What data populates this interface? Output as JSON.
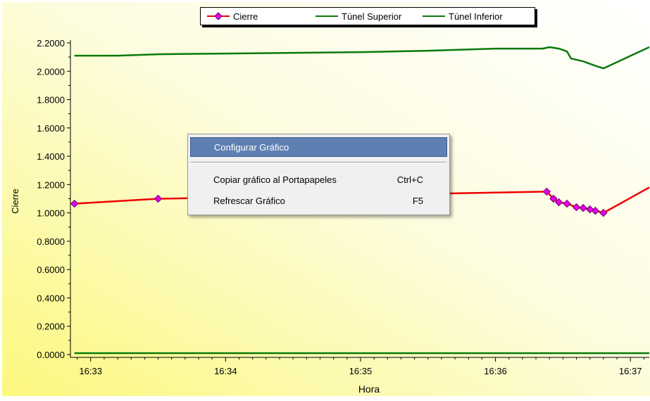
{
  "chart_data": {
    "type": "line",
    "ylabel": "Cierre",
    "xlabel": "Hora",
    "ylim": [
      0,
      2.2
    ],
    "xlim_minutes": [
      32.85,
      37.14
    ],
    "y_ticks": [
      "0.0000",
      "0.2000",
      "0.4000",
      "0.6000",
      "0.8000",
      "1.0000",
      "1.2000",
      "1.4000",
      "1.6000",
      "1.8000",
      "2.0000",
      "2.2000"
    ],
    "x_ticks": [
      {
        "label": "16:33",
        "t": 33
      },
      {
        "label": "16:34",
        "t": 34
      },
      {
        "label": "16:35",
        "t": 35
      },
      {
        "label": "16:36",
        "t": 36
      },
      {
        "label": "16:37",
        "t": 37
      }
    ],
    "grid": false,
    "legend_position": "top-center",
    "series": [
      {
        "name": "Cierre",
        "color": "#ee0000",
        "marker_color": "#e600e6",
        "markers": true,
        "points": [
          [
            32.88,
            1.065
          ],
          [
            33.5,
            1.1
          ],
          [
            36.38,
            1.15
          ],
          [
            36.43,
            1.1
          ],
          [
            36.47,
            1.075
          ],
          [
            36.53,
            1.065
          ],
          [
            36.6,
            1.04
          ],
          [
            36.65,
            1.035
          ],
          [
            36.7,
            1.025
          ],
          [
            36.74,
            1.015
          ],
          [
            36.8,
            1.0
          ],
          [
            37.14,
            1.18
          ]
        ]
      },
      {
        "name": "Túnel Superior",
        "color": "#0a7a0a",
        "markers": false,
        "points": [
          [
            32.88,
            2.11
          ],
          [
            33.2,
            2.11
          ],
          [
            33.5,
            2.12
          ],
          [
            34.0,
            2.125
          ],
          [
            34.5,
            2.13
          ],
          [
            35.0,
            2.135
          ],
          [
            35.5,
            2.145
          ],
          [
            36.0,
            2.16
          ],
          [
            36.35,
            2.16
          ],
          [
            36.4,
            2.17
          ],
          [
            36.47,
            2.16
          ],
          [
            36.53,
            2.14
          ],
          [
            36.56,
            2.09
          ],
          [
            36.65,
            2.07
          ],
          [
            36.75,
            2.035
          ],
          [
            36.8,
            2.02
          ],
          [
            37.14,
            2.17
          ]
        ]
      },
      {
        "name": "Túnel Inferior",
        "color": "#0a7a0a",
        "markers": false,
        "points": [
          [
            32.88,
            0.01
          ],
          [
            37.14,
            0.01
          ]
        ]
      }
    ]
  },
  "context_menu": {
    "items": [
      {
        "label": "Configurar Gráfico",
        "shortcut": "",
        "highlighted": true
      },
      {
        "label": "Copiar gráfico al Portapapeles",
        "shortcut": "Ctrl+C",
        "highlighted": false
      },
      {
        "label": "Refrescar Gráfico",
        "shortcut": "F5",
        "highlighted": false
      }
    ]
  },
  "colors": {
    "plot_bg_left": "#fcf87e",
    "plot_bg_right": "#ffffff"
  }
}
